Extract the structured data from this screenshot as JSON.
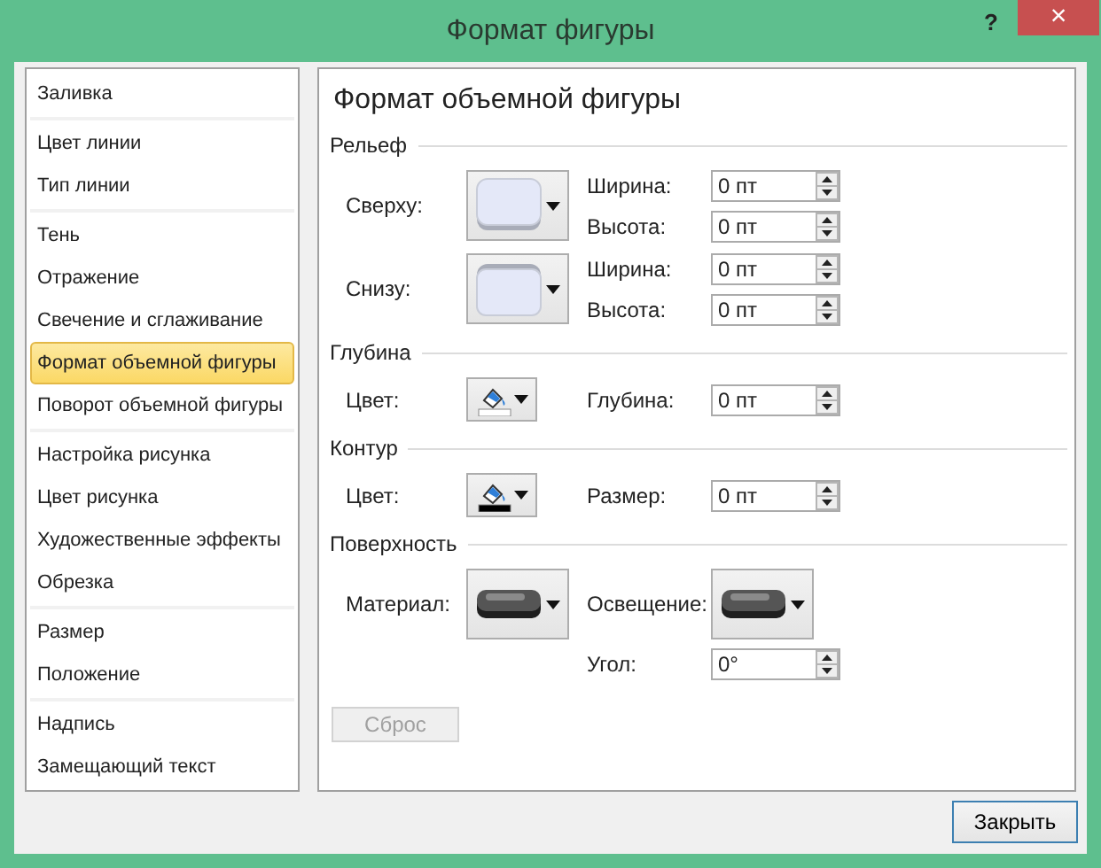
{
  "window": {
    "title": "Формат фигуры",
    "help": "?",
    "close": "×"
  },
  "sidebar": {
    "groups": [
      [
        {
          "label": "Заливка",
          "selected": false
        }
      ],
      [
        {
          "label": "Цвет линии",
          "selected": false
        },
        {
          "label": "Тип линии",
          "selected": false
        }
      ],
      [
        {
          "label": "Тень",
          "selected": false
        },
        {
          "label": "Отражение",
          "selected": false
        },
        {
          "label": "Свечение и сглаживание",
          "selected": false
        },
        {
          "label": "Формат объемной фигуры",
          "selected": true
        },
        {
          "label": "Поворот объемной фигуры",
          "selected": false
        }
      ],
      [
        {
          "label": "Настройка рисунка",
          "selected": false
        },
        {
          "label": "Цвет рисунка",
          "selected": false
        },
        {
          "label": "Художественные эффекты",
          "selected": false
        },
        {
          "label": "Обрезка",
          "selected": false
        }
      ],
      [
        {
          "label": "Размер",
          "selected": false
        },
        {
          "label": "Положение",
          "selected": false
        }
      ],
      [
        {
          "label": "Надпись",
          "selected": false
        },
        {
          "label": "Замещающий текст",
          "selected": false
        }
      ]
    ]
  },
  "panel": {
    "title": "Формат объемной фигуры",
    "sections": [
      {
        "heading": "Рельеф",
        "rows": [
          {
            "label": "Сверху:",
            "control": {
              "kind": "bevel-top"
            },
            "items": [
              {
                "label": "Ширина:",
                "kind": "spin",
                "value": "0 пт"
              },
              {
                "label": "Высота:",
                "kind": "spin",
                "value": "0 пт"
              }
            ]
          },
          {
            "label": "Снизу:",
            "control": {
              "kind": "bevel-bottom"
            },
            "items": [
              {
                "label": "Ширина:",
                "kind": "spin",
                "value": "0 пт"
              },
              {
                "label": "Высота:",
                "kind": "spin",
                "value": "0 пт"
              }
            ]
          }
        ]
      },
      {
        "heading": "Глубина",
        "rows": [
          {
            "label": "Цвет:",
            "control": {
              "kind": "fill",
              "color": "#ffffff"
            },
            "items": [
              {
                "label": "Глубина:",
                "kind": "spin",
                "value": "0 пт"
              }
            ]
          }
        ]
      },
      {
        "heading": "Контур",
        "rows": [
          {
            "label": "Цвет:",
            "control": {
              "kind": "fill",
              "color": "#000000"
            },
            "items": [
              {
                "label": "Размер:",
                "kind": "spin",
                "value": "0 пт"
              }
            ]
          }
        ]
      },
      {
        "heading": "Поверхность",
        "rows": [
          {
            "label": "Материал:",
            "control": {
              "kind": "material"
            },
            "items": [
              {
                "label": "Освещение:",
                "kind": "material"
              },
              {
                "label": "Угол:",
                "kind": "spin",
                "value": "0°"
              }
            ]
          }
        ]
      }
    ],
    "reset": {
      "label": "Сброс",
      "disabled": true
    }
  },
  "footer": {
    "button": "Закрыть"
  }
}
